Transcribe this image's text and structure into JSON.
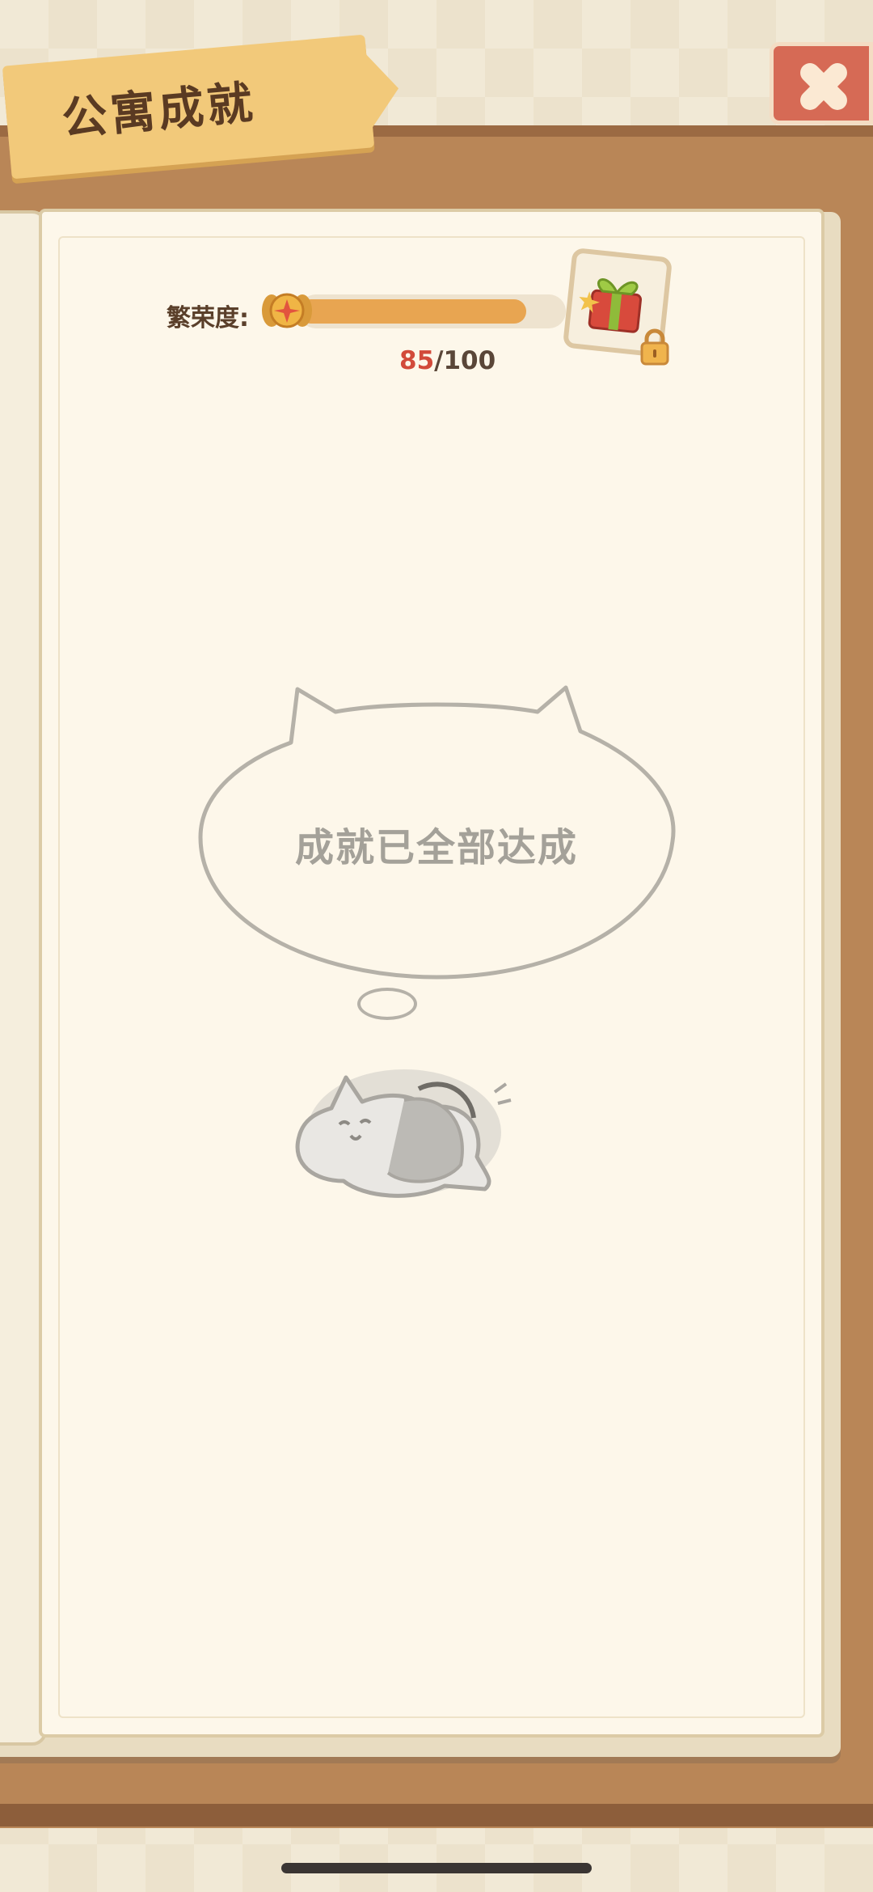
{
  "header": {
    "title": "公寓成就",
    "close_icon": "close-icon"
  },
  "prosperity": {
    "label": "繁荣度:",
    "current": "85",
    "separator": "/",
    "max": "100",
    "progress": 0.85,
    "reward_icon": "gift-icon",
    "locked_icon": "lock-icon"
  },
  "empty_state": {
    "message": "成就已全部达成",
    "illustration": "sleeping-cat-icon"
  },
  "colors": {
    "bar_fill": "#e8a551",
    "current_value": "#d24a3a",
    "close_button": "#d66a55"
  }
}
